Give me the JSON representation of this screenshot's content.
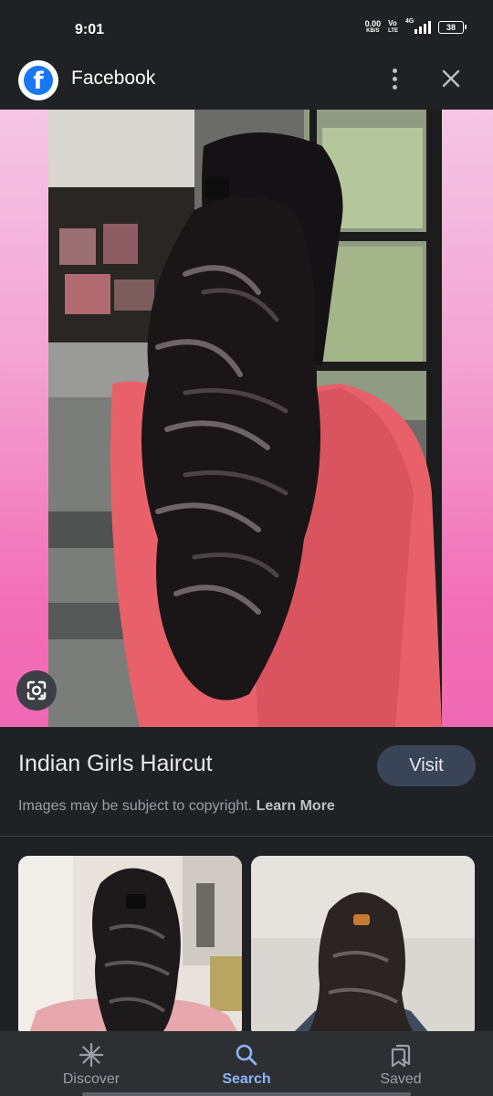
{
  "status_bar": {
    "time": "9:01",
    "net_speed": "0.00",
    "net_unit": "KB/S",
    "volte_top": "Vo",
    "volte_bottom": "LTE",
    "network": "4G",
    "battery": "38"
  },
  "header": {
    "site_name": "Facebook",
    "logo_letter": "f",
    "menu_icon": "more-vert-icon",
    "close_icon": "close-icon"
  },
  "hero": {
    "lens_icon": "google-lens-icon"
  },
  "result": {
    "title": "Indian Girls Haircut",
    "visit_label": "Visit",
    "copyright_text": "Images may be subject to copyright.",
    "learn_more": "Learn More"
  },
  "bottom_nav": {
    "items": [
      {
        "label": "Discover",
        "icon": "asterisk-icon",
        "active": false
      },
      {
        "label": "Search",
        "icon": "search-icon",
        "active": true
      },
      {
        "label": "Saved",
        "icon": "bookmarks-icon",
        "active": false
      }
    ]
  },
  "colors": {
    "background": "#202124",
    "accent": "#8ab4f8",
    "visit_button": "#394457",
    "facebook_blue": "#1877f2"
  }
}
